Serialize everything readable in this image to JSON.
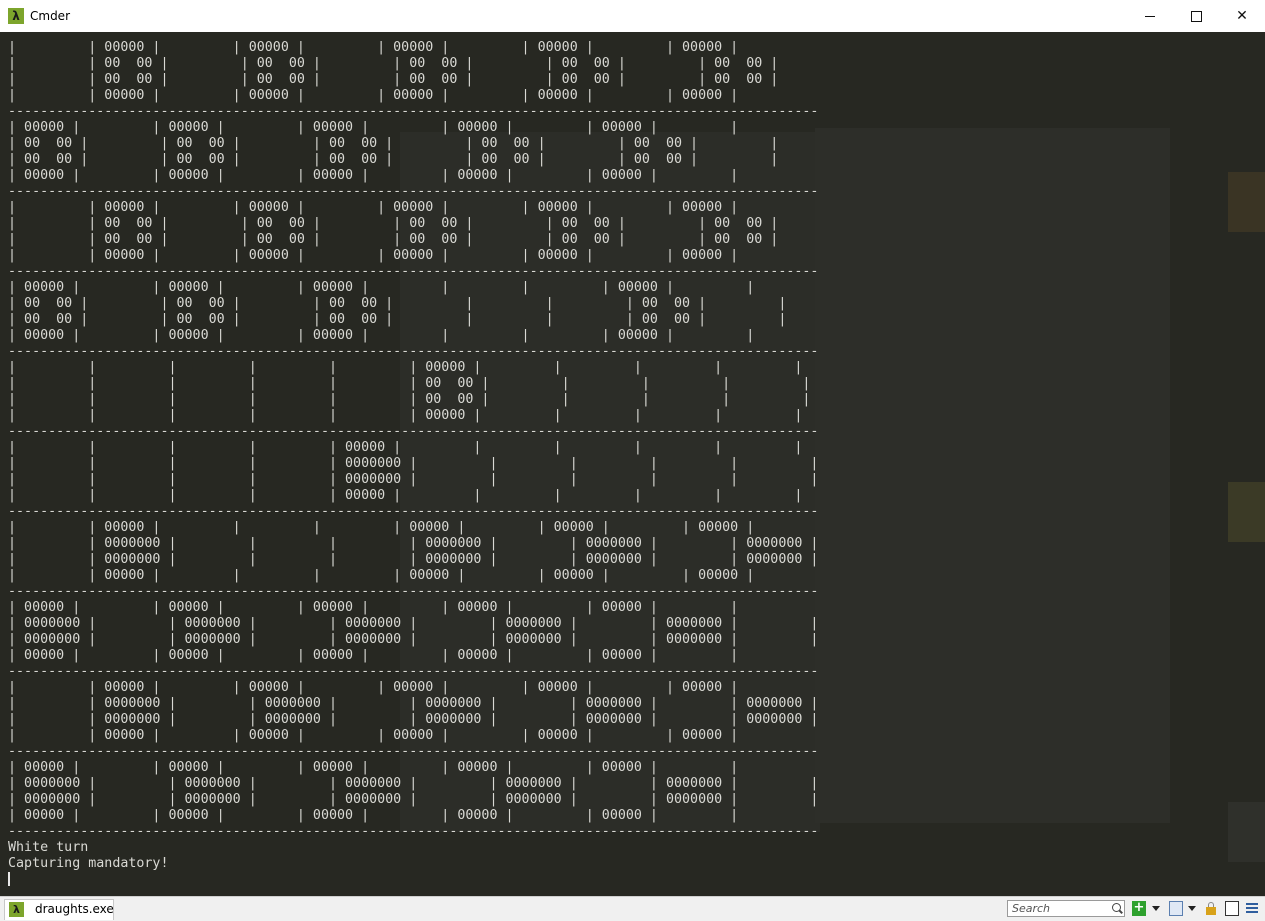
{
  "window": {
    "title": "Cmder",
    "app_icon_glyph": "λ"
  },
  "terminal": {
    "board_lines": [
      "|         | 00000 |         | 00000 |         | 00000 |         | 00000 |         | 00000 |",
      "|         | 00  00 |         | 00  00 |         | 00  00 |         | 00  00 |         | 00  00 |",
      "|         | 00  00 |         | 00  00 |         | 00  00 |         | 00  00 |         | 00  00 |",
      "|         | 00000 |         | 00000 |         | 00000 |         | 00000 |         | 00000 |",
      "-----------------------------------------------------------------------------------------------------",
      "| 00000 |         | 00000 |         | 00000 |         | 00000 |         | 00000 |         |",
      "| 00  00 |         | 00  00 |         | 00  00 |         | 00  00 |         | 00  00 |         |",
      "| 00  00 |         | 00  00 |         | 00  00 |         | 00  00 |         | 00  00 |         |",
      "| 00000 |         | 00000 |         | 00000 |         | 00000 |         | 00000 |         |",
      "-----------------------------------------------------------------------------------------------------",
      "|         | 00000 |         | 00000 |         | 00000 |         | 00000 |         | 00000 |",
      "|         | 00  00 |         | 00  00 |         | 00  00 |         | 00  00 |         | 00  00 |",
      "|         | 00  00 |         | 00  00 |         | 00  00 |         | 00  00 |         | 00  00 |",
      "|         | 00000 |         | 00000 |         | 00000 |         | 00000 |         | 00000 |",
      "-----------------------------------------------------------------------------------------------------",
      "| 00000 |         | 00000 |         | 00000 |         |         |         | 00000 |         |",
      "| 00  00 |         | 00  00 |         | 00  00 |         |         |         | 00  00 |         |",
      "| 00  00 |         | 00  00 |         | 00  00 |         |         |         | 00  00 |         |",
      "| 00000 |         | 00000 |         | 00000 |         |         |         | 00000 |         |",
      "-----------------------------------------------------------------------------------------------------",
      "|         |         |         |         |         | 00000 |         |         |         |         |",
      "|         |         |         |         |         | 00  00 |         |         |         |         |",
      "|         |         |         |         |         | 00  00 |         |         |         |         |",
      "|         |         |         |         |         | 00000 |         |         |         |         |",
      "-----------------------------------------------------------------------------------------------------",
      "|         |         |         |         | 00000 |         |         |         |         |         |",
      "|         |         |         |         | 0000000 |         |         |         |         |         |",
      "|         |         |         |         | 0000000 |         |         |         |         |         |",
      "|         |         |         |         | 00000 |         |         |         |         |         |",
      "-----------------------------------------------------------------------------------------------------",
      "|         | 00000 |         |         |         | 00000 |         | 00000 |         | 00000 |",
      "|         | 0000000 |         |         |         | 0000000 |         | 0000000 |         | 0000000 |",
      "|         | 0000000 |         |         |         | 0000000 |         | 0000000 |         | 0000000 |",
      "|         | 00000 |         |         |         | 00000 |         | 00000 |         | 00000 |",
      "-----------------------------------------------------------------------------------------------------",
      "| 00000 |         | 00000 |         | 00000 |         | 00000 |         | 00000 |         |",
      "| 0000000 |         | 0000000 |         | 0000000 |         | 0000000 |         | 0000000 |         |",
      "| 0000000 |         | 0000000 |         | 0000000 |         | 0000000 |         | 0000000 |         |",
      "| 00000 |         | 00000 |         | 00000 |         | 00000 |         | 00000 |         |",
      "-----------------------------------------------------------------------------------------------------",
      "|         | 00000 |         | 00000 |         | 00000 |         | 00000 |         | 00000 |",
      "|         | 0000000 |         | 0000000 |         | 0000000 |         | 0000000 |         | 0000000 |",
      "|         | 0000000 |         | 0000000 |         | 0000000 |         | 0000000 |         | 0000000 |",
      "|         | 00000 |         | 00000 |         | 00000 |         | 00000 |         | 00000 |",
      "-----------------------------------------------------------------------------------------------------",
      "| 00000 |         | 00000 |         | 00000 |         | 00000 |         | 00000 |         |",
      "| 0000000 |         | 0000000 |         | 0000000 |         | 0000000 |         | 0000000 |         |",
      "| 0000000 |         | 0000000 |         | 0000000 |         | 0000000 |         | 0000000 |         |",
      "| 00000 |         | 00000 |         | 00000 |         | 00000 |         | 00000 |         |",
      "-----------------------------------------------------------------------------------------------------"
    ],
    "turn_message": "White turn",
    "status_message": "Capturing mandatory!"
  },
  "statusbar": {
    "tab_label": "draughts.exe",
    "tab_icon_glyph": "λ",
    "search_placeholder": "Search",
    "new_console_glyph": "+"
  },
  "colors": {
    "console_background": "#272822",
    "console_text": "#d9d9d4",
    "cmder_accent": "#7da52c"
  }
}
